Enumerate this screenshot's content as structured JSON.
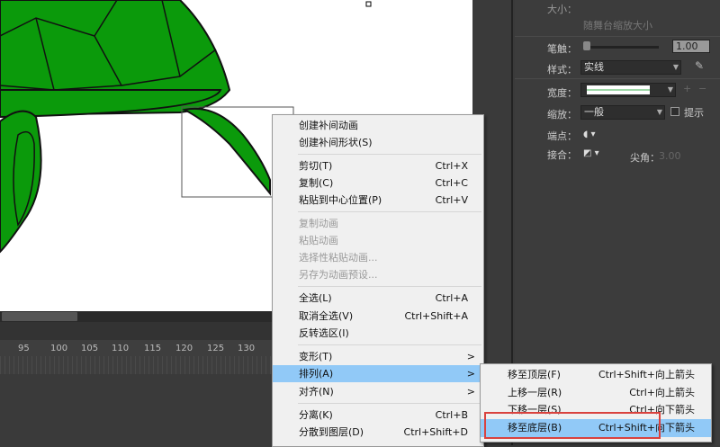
{
  "panel": {
    "size_label": "大小：",
    "sync_checkbox": "随舞台缩放大小",
    "stroke_label": "笔触：",
    "stroke_value": "1.00",
    "style_label": "样式：",
    "style_value": "实线",
    "width_label": "宽度：",
    "scale_label": "缩放：",
    "scale_value": "一般",
    "hint_label": "提示",
    "cap_label": "端点：",
    "join_label": "接合：",
    "miter_label": "尖角：",
    "miter_value": "3.00"
  },
  "timeline": {
    "ticks": [
      "95",
      "100",
      "105",
      "110",
      "115",
      "120",
      "125",
      "130"
    ]
  },
  "colors": {
    "turtle": "#0b9a0b",
    "highlight": "#91c9f7",
    "annotation": "#d9423e"
  },
  "context_menu": {
    "items": [
      {
        "label": "创建补间动画",
        "shortcut": ""
      },
      {
        "label": "创建补间形状(S)",
        "shortcut": ""
      },
      {
        "label": "剪切(T)",
        "shortcut": "Ctrl+X"
      },
      {
        "label": "复制(C)",
        "shortcut": "Ctrl+C"
      },
      {
        "label": "粘贴到中心位置(P)",
        "shortcut": "Ctrl+V"
      },
      {
        "label": "复制动画",
        "shortcut": ""
      },
      {
        "label": "粘贴动画",
        "shortcut": ""
      },
      {
        "label": "选择性粘贴动画...",
        "shortcut": ""
      },
      {
        "label": "另存为动画预设...",
        "shortcut": ""
      },
      {
        "label": "全选(L)",
        "shortcut": "Ctrl+A"
      },
      {
        "label": "取消全选(V)",
        "shortcut": "Ctrl+Shift+A"
      },
      {
        "label": "反转选区(I)",
        "shortcut": ""
      },
      {
        "label": "变形(T)",
        "shortcut": ""
      },
      {
        "label": "排列(A)",
        "shortcut": ""
      },
      {
        "label": "对齐(N)",
        "shortcut": ""
      },
      {
        "label": "分离(K)",
        "shortcut": "Ctrl+B"
      },
      {
        "label": "分散到图层(D)",
        "shortcut": "Ctrl+Shift+D"
      }
    ],
    "submenu_arrow": ">"
  },
  "arrange_submenu": {
    "items": [
      {
        "label": "移至顶层(F)",
        "shortcut": "Ctrl+Shift+向上箭头"
      },
      {
        "label": "上移一层(R)",
        "shortcut": "Ctrl+向上箭头"
      },
      {
        "label": "下移一层(S)",
        "shortcut": "Ctrl+向下箭头"
      },
      {
        "label": "移至底层(B)",
        "shortcut": "Ctrl+Shift+向下箭头"
      }
    ]
  }
}
